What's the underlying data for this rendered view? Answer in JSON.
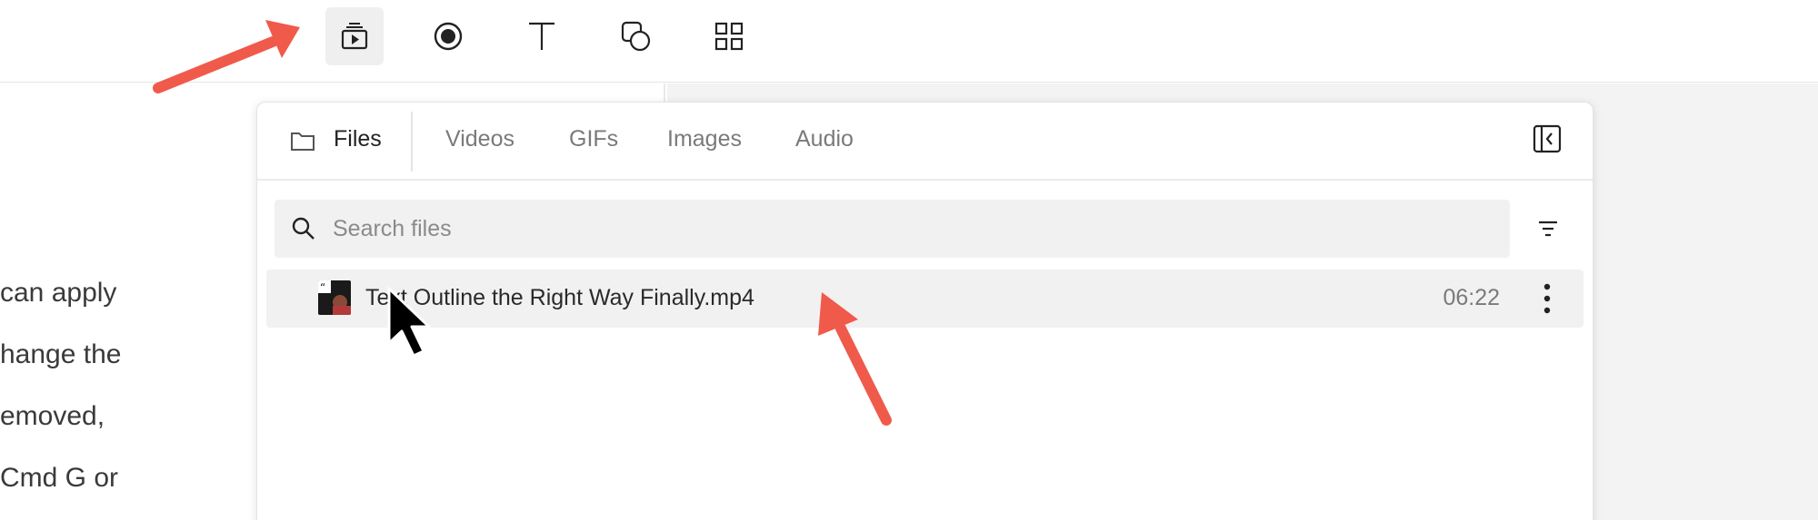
{
  "toolbar": {
    "tools": [
      {
        "id": "media",
        "icon": "media-library-icon",
        "active": true
      },
      {
        "id": "record",
        "icon": "record-icon",
        "active": false
      },
      {
        "id": "text",
        "icon": "text-icon",
        "active": false
      },
      {
        "id": "shapes",
        "icon": "shapes-icon",
        "active": false
      },
      {
        "id": "elements",
        "icon": "grid-icon",
        "active": false
      }
    ]
  },
  "document": {
    "lines": [
      "can apply",
      "hange the",
      "emoved,",
      "Cmd G or"
    ]
  },
  "panel": {
    "tabs": {
      "files": "Files",
      "videos": "Videos",
      "gifs": "GIFs",
      "images": "Images",
      "audio": "Audio"
    },
    "search": {
      "placeholder": "Search files",
      "value": ""
    },
    "files": [
      {
        "name": "Text Outline the Right Way Finally.mp4",
        "duration": "06:22"
      }
    ]
  },
  "colors": {
    "accent_arrow": "#f05a4b",
    "row_bg": "#f1f1f1",
    "active_tool_bg": "#efefef"
  }
}
